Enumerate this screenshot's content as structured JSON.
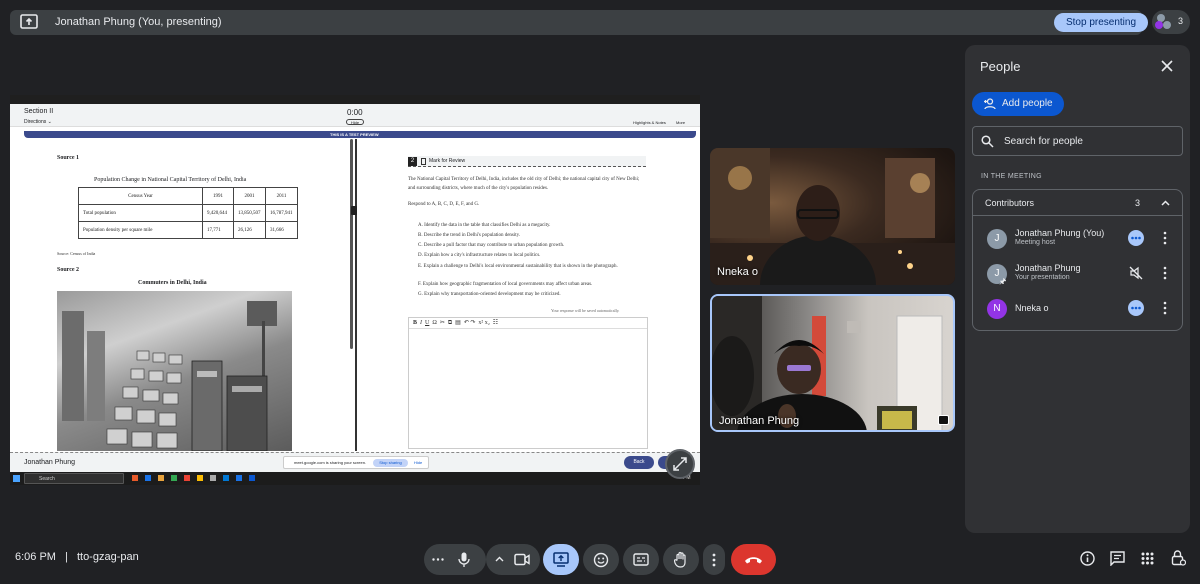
{
  "banner": {
    "title": "Jonathan Phung (You, presenting)",
    "stop_label": "Stop presenting",
    "participant_count": "3"
  },
  "shared_screen": {
    "section": "Section II",
    "directions": "Directions ⌄",
    "timer": "0:00",
    "hide_label": "Hide",
    "highlights": "Highlights & Notes",
    "more": "More",
    "preview_banner": "THIS IS A TEST PREVIEW",
    "source1": "Source 1",
    "table_title": "Population Change in National Capital Territory of Delhi, India",
    "table_header": [
      "Census Year",
      "1991",
      "2001",
      "2011"
    ],
    "table_rows": [
      [
        "Total population",
        "9,420,644",
        "13,850,507",
        "16,787,941"
      ],
      [
        "Population density per square mile",
        "17,771",
        "26,126",
        "31,666"
      ]
    ],
    "table_source": "Source: Census of India",
    "source2": "Source 2",
    "photo_title": "Commuters in Delhi, India",
    "question_number": "2",
    "mark_review": "Mark for Review",
    "prompt": "The National Capital Territory of Delhi, India, includes the old city of Delhi; the national capital city of New Delhi; and surrounding districts, where much of the city's population resides.",
    "respond": "Respond to A, B, C, D, E, F, and G.",
    "items": [
      "A. Identify the data in the table that classifies Delhi as a megacity.",
      "B. Describe the trend in Delhi's population density.",
      "C. Describe a pull factor that may contribute to urban population growth.",
      "D. Explain how a city's infrastructure relates to local politics.",
      "E. Explain a challenge to Delhi's local environmental sustainability that is shown in the photograph.",
      "F. Explain how geographic fragmentation of local governments may affect urban areas.",
      "G. Explain why transportation-oriented development may be criticized."
    ],
    "autosave": "Your response will be saved automatically.",
    "student_name": "Jonathan Phung",
    "sharing_msg": "meet.google.com is sharing your screen.",
    "stop_sharing": "Stop sharing",
    "hide": "Hide",
    "back": "Back",
    "taskbar_search": "Search",
    "taskbar_time": "PM"
  },
  "tiles": [
    {
      "name": "Nneka o"
    },
    {
      "name": "Jonathan Phung"
    }
  ],
  "people_panel": {
    "title": "People",
    "add_people": "Add people",
    "search_placeholder": "Search for people",
    "section_label": "IN THE MEETING",
    "group_label": "Contributors",
    "group_count": "3",
    "participants": [
      {
        "initial": "J",
        "name": "Jonathan Phung (You)",
        "role": "Meeting host",
        "color": "#8c9aa8"
      },
      {
        "initial": "J",
        "name": "Jonathan Phung",
        "role": "Your presentation",
        "color": "#8c9aa8"
      },
      {
        "initial": "N",
        "name": "Nneka o",
        "role": "",
        "color": "#9334e6"
      }
    ]
  },
  "footer": {
    "time": "6:06 PM",
    "separator": "|",
    "meeting_code": "tto-gzag-pan"
  },
  "colors": {
    "accent": "#a8c7fa",
    "end_call": "#dc362e",
    "present_active": "#a8c7fa"
  }
}
